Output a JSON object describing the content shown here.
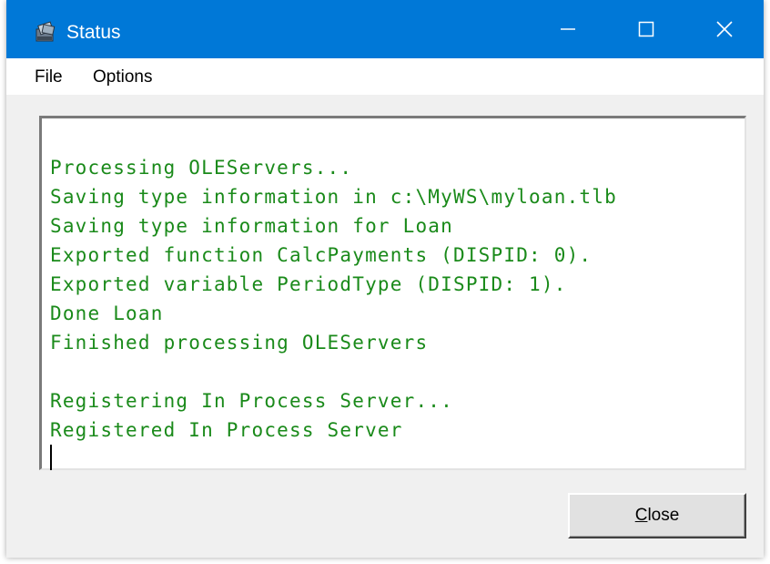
{
  "window": {
    "title": "Status",
    "icon": "status-app-icon",
    "controls": {
      "minimize_icon": "minimize-icon",
      "maximize_icon": "maximize-icon",
      "close_icon": "close-icon"
    }
  },
  "menu": {
    "items": [
      {
        "label": "File"
      },
      {
        "label": "Options"
      }
    ]
  },
  "log": {
    "lines": [
      "Processing OLEServers...",
      "Saving type information in c:\\MyWS\\myloan.tlb",
      "Saving type information for Loan",
      "Exported function CalcPayments (DISPID: 0).",
      "Exported variable PeriodType (DISPID: 1).",
      "Done Loan",
      "Finished processing OLEServers",
      "",
      "Registering In Process Server...",
      "Registered In Process Server"
    ],
    "text_color": "#1a8a1a"
  },
  "buttons": {
    "close": {
      "mnemonic": "C",
      "rest": "lose"
    }
  },
  "colors": {
    "titlebar": "#0078d7",
    "window_bg": "#f0f0f0"
  }
}
